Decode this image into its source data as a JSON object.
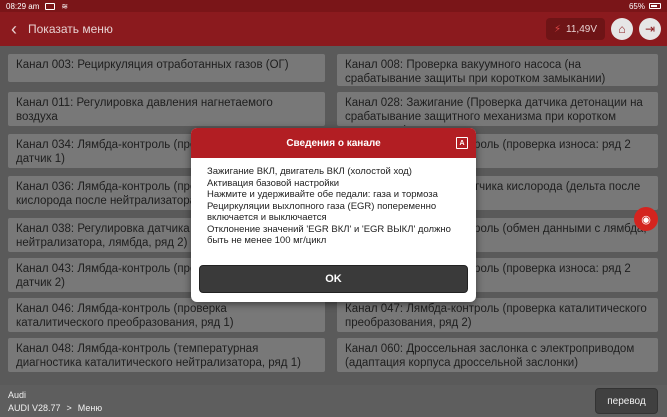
{
  "status_bar": {
    "time": "08:29 am",
    "battery": "65%"
  },
  "header": {
    "title": "Показать меню",
    "voltage": "11,49V"
  },
  "rows": [
    {
      "left": "Канал 003: Рециркуляция отработанных газов (ОГ)",
      "right": "Канал 008: Проверка вакуумного насоса (на срабатывание защиты при коротком замыкании)"
    },
    {
      "left": "Канал 011: Регулировка давления нагнетаемого воздуха",
      "right": "Канал 028: Зажигание (Проверка датчика детонации на срабатывание защитного механизма при коротком замыкании)"
    },
    {
      "left": "Канал 034: Лямбда-контроль (проверка износа: ряд 1 датчик 1)",
      "right": "Канал 035: Лямбда-контроль (проверка износа: ряд 2 датчик 1)"
    },
    {
      "left": "Канал 036: Лямбда-контроль (проверка датчика кислорода после нейтрализатора)",
      "right": "Канал 037: Проверка датчика кислорода (дельта после нейтрализатора)"
    },
    {
      "left": "Канал 038: Регулировка датчика кислорода после нейтрализатора, лямбда, ряд 2)",
      "right": "Канал 039: Лямбда-контроль (обмен данными с лямбда, ряд 2)"
    },
    {
      "left": "Канал 043: Лямбда-контроль (проверка износа: ряд 2 датчик 2)",
      "right": "Канал 044: Лямбда-контроль (проверка износа: ряд 2 датчик 2)"
    },
    {
      "left": "Канал 046: Лямбда-контроль (проверка каталитического преобразования, ряд 1)",
      "right": "Канал 047: Лямбда-контроль (проверка каталитического преобразования, ряд 2)"
    },
    {
      "left": "Канал 048: Лямбда-контроль (температурная диагностика каталитического нейтрализатора, ряд 1)",
      "right": "Канал 060: Дроссельная заслонка с электроприводом (адаптация корпуса дроссельной заслонки)"
    }
  ],
  "dialog": {
    "title": "Сведения о канале",
    "body": "Зажигание ВКЛ, двигатель ВКЛ (холостой ход)\nАктивация базовой настройки\nНажмите и удерживайте обе педали: газа и тормоза\nРециркуляции выхлопного газа (EGR) попеременно\nвключается и выключается\nОтклонение значений 'EGR ВКЛ' и 'EGR ВЫКЛ' должно\nбыть не менее 100 мг/цикл",
    "ok": "OK"
  },
  "footer": {
    "make": "Audi",
    "version": "AUDI V28.77",
    "path": "Меню",
    "translate": "перевод"
  },
  "colors": {
    "header": "#8b1a1e",
    "dialog_header": "#b21e23",
    "camera": "#d4241f"
  },
  "icons": [
    "back-icon",
    "lightning-icon",
    "home-icon",
    "exit-icon",
    "camera-icon",
    "wifi-icon",
    "battery-icon",
    "page-icon"
  ]
}
